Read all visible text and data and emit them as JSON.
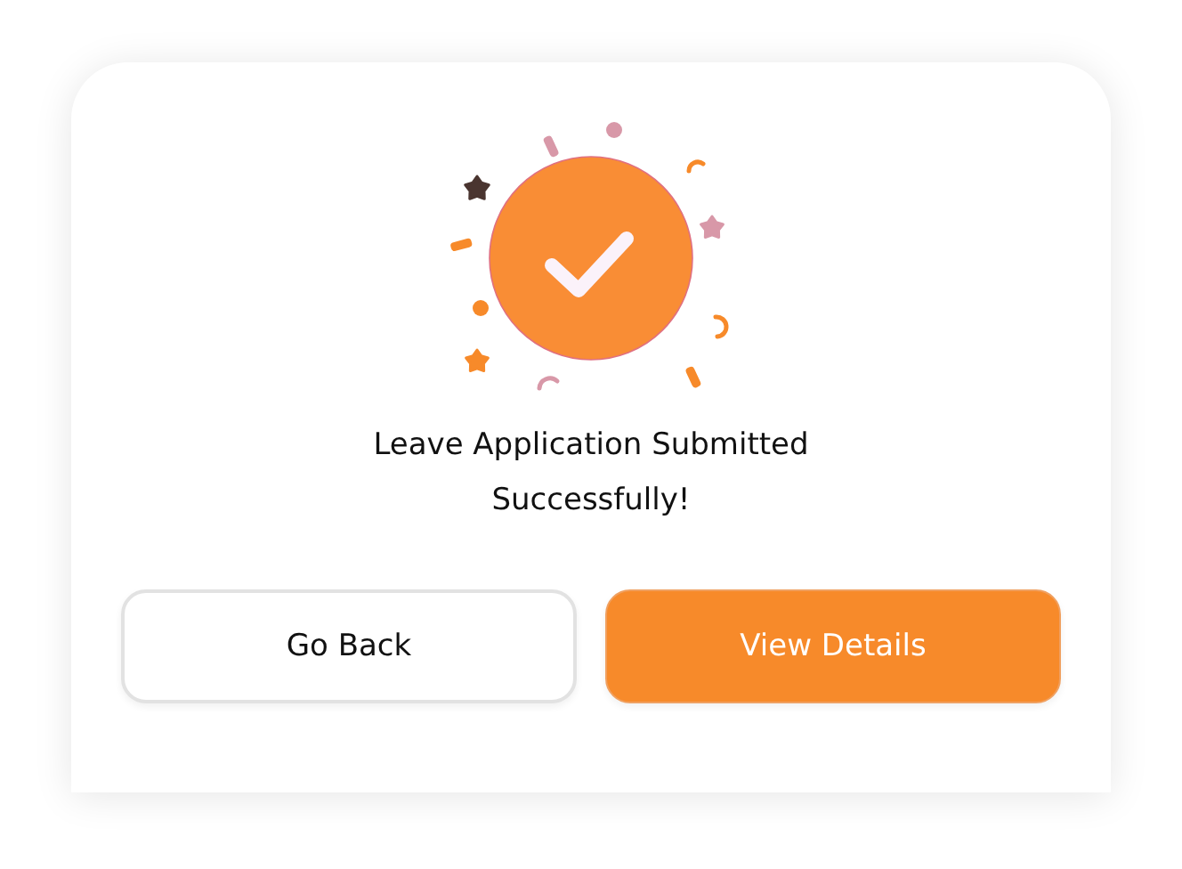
{
  "dialog": {
    "title": "Leave Application Submitted Successfully!",
    "buttons": [
      {
        "label": "Go Back",
        "kind": "secondary"
      },
      {
        "label": "View Details",
        "kind": "primary"
      }
    ]
  }
}
